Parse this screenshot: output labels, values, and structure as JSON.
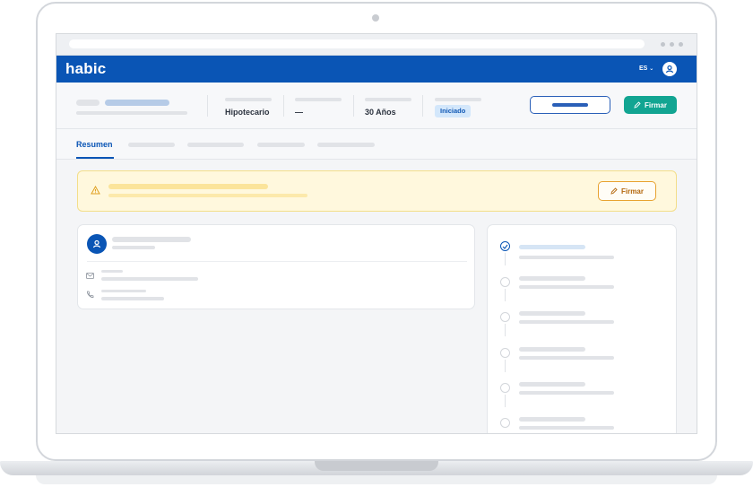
{
  "app": {
    "logo": "habic"
  },
  "nav": {
    "language": "ES"
  },
  "header": {
    "fields": [
      {
        "value": "Hipotecario"
      },
      {
        "value": "—"
      },
      {
        "value": "30 Años"
      }
    ],
    "status_badge": "Iniciado",
    "sign_button": "Firmar"
  },
  "tabs": {
    "active": "Resumen"
  },
  "alert": {
    "sign_button": "Firmar"
  },
  "colors": {
    "brand": "#0a55b5",
    "teal": "#12a592",
    "warning": "#e8a230"
  }
}
